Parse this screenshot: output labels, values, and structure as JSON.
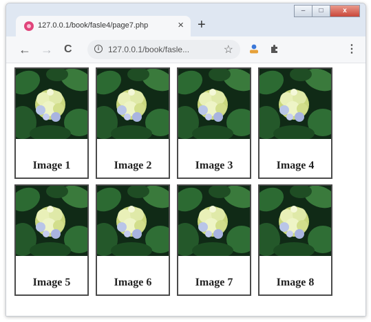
{
  "window": {
    "tab_title": "127.0.0.1/book/fasle4/page7.php",
    "tab_close": "×",
    "new_tab": "+",
    "controls": {
      "minimize": "–",
      "maximize": "□",
      "close": "x"
    }
  },
  "toolbar": {
    "back": "←",
    "forward": "→",
    "reload": "C",
    "url": "127.0.0.1/book/fasle...",
    "info_glyph": "i",
    "star": "☆",
    "menu": "⋮",
    "icons": [
      "arrow-left-icon",
      "arrow-right-icon",
      "reload-icon",
      "info-icon",
      "star-icon",
      "account-icon",
      "extensions-icon",
      "menu-icon"
    ]
  },
  "gallery": {
    "images": [
      {
        "caption": "Image 1"
      },
      {
        "caption": "Image 2"
      },
      {
        "caption": "Image 3"
      },
      {
        "caption": "Image 4"
      },
      {
        "caption": "Image 5"
      },
      {
        "caption": "Image 6"
      },
      {
        "caption": "Image 7"
      },
      {
        "caption": "Image 8"
      }
    ]
  },
  "colors": {
    "tabstrip": "#dfe7f2",
    "card_border": "#4a4a4a",
    "leaf_dark": "#12331a",
    "flower": "#dfe9a8"
  }
}
